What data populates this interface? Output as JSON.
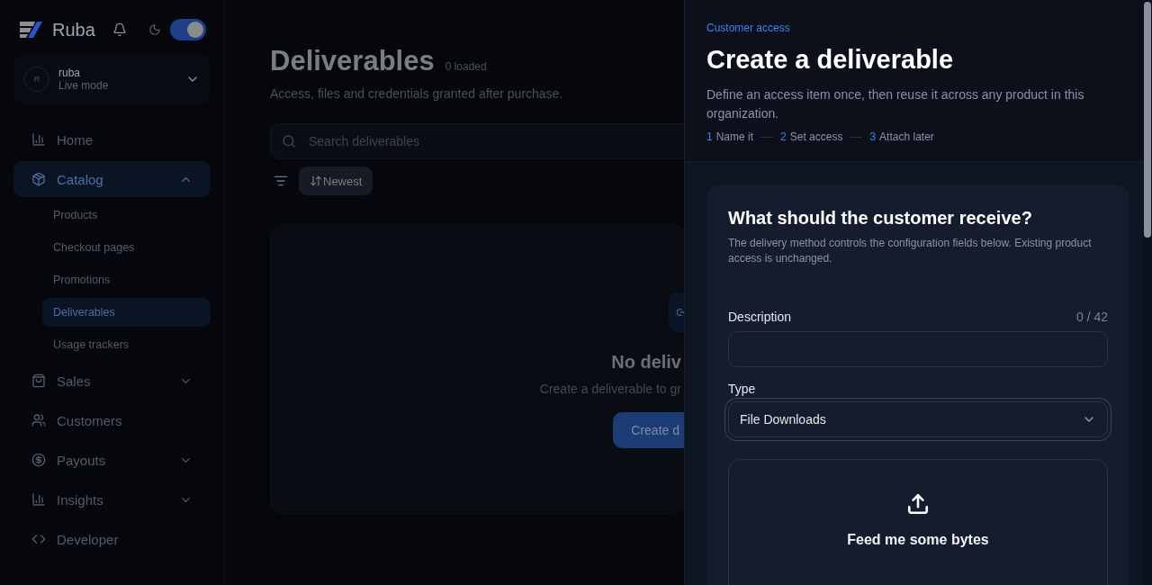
{
  "sidebar": {
    "brand": "Ruba",
    "theme_toggle": {
      "on": true
    },
    "account": {
      "avatar": "R",
      "name": "ruba",
      "mode": "Live mode"
    },
    "nav": [
      {
        "label": "Home",
        "kind": "link",
        "selected": false
      },
      {
        "label": "Catalog",
        "kind": "group",
        "selected": true,
        "expanded": true,
        "children": [
          {
            "label": "Products",
            "selected": false
          },
          {
            "label": "Checkout pages",
            "selected": false
          },
          {
            "label": "Promotions",
            "selected": false
          },
          {
            "label": "Deliverables",
            "selected": true
          },
          {
            "label": "Usage trackers",
            "selected": false
          }
        ]
      },
      {
        "label": "Sales",
        "kind": "group",
        "selected": false,
        "expanded": false
      },
      {
        "label": "Customers",
        "kind": "link",
        "selected": false
      },
      {
        "label": "Payouts",
        "kind": "group",
        "selected": false,
        "expanded": false
      },
      {
        "label": "Insights",
        "kind": "group",
        "selected": false,
        "expanded": false
      },
      {
        "label": "Developer",
        "kind": "link",
        "selected": false
      }
    ]
  },
  "main": {
    "title": "Deliverables",
    "count": "0 loaded",
    "subtitle": "Access, files and credentials granted after purchase.",
    "search": {
      "placeholder": "Search deliverables"
    },
    "sort": {
      "label": "Newest"
    },
    "empty_state": {
      "title": "No deliv",
      "text": "Create a deliverable to gr",
      "button": "Create d"
    }
  },
  "drawer": {
    "eyebrow": "Customer access",
    "title": "Create a deliverable",
    "description": "Define an access item once, then reuse it across any product in this organization.",
    "steps": [
      {
        "number": "1",
        "label": "Name it"
      },
      {
        "number": "2",
        "label": "Set access"
      },
      {
        "number": "3",
        "label": "Attach later"
      }
    ],
    "card": {
      "title": "What should the customer receive?",
      "text": "The delivery method controls the configuration fields below. Existing product access is unchanged.",
      "description_field": {
        "label": "Description",
        "counter": "0 / 42"
      },
      "type_field": {
        "label": "Type",
        "value": "File Downloads",
        "focused": true
      },
      "upload": {
        "title": "Feed me some bytes"
      }
    }
  }
}
